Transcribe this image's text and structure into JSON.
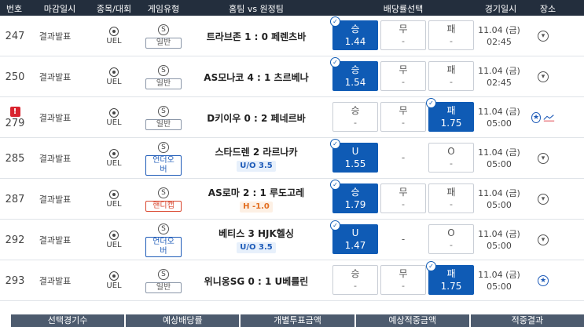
{
  "headers": [
    "번호",
    "마감일시",
    "종목/대회",
    "게임유형",
    "홈팀 vs 원정팀",
    "배당률선택",
    "경기일시",
    "장소"
  ],
  "rows": [
    {
      "no": "247",
      "status": "결과발표",
      "league": "UEL",
      "s": "S",
      "gtype": "일반",
      "gtype_style": "gray",
      "match": "트라브존 1 : 0 페렌츠바",
      "sub": "",
      "sub_style": "",
      "b1": {
        "label": "승",
        "odds": "1.44"
      },
      "b2": {
        "label": "무",
        "odds": "-"
      },
      "b3": {
        "label": "패",
        "odds": "-"
      },
      "sel": 1,
      "date": "11.04 (금)",
      "time": "02:45",
      "warn": false,
      "chart": false,
      "pin_blue": false
    },
    {
      "no": "250",
      "status": "결과발표",
      "league": "UEL",
      "s": "S",
      "gtype": "일반",
      "gtype_style": "gray",
      "match": "AS모나코 4 : 1 츠르베나",
      "sub": "",
      "sub_style": "",
      "b1": {
        "label": "승",
        "odds": "1.54"
      },
      "b2": {
        "label": "무",
        "odds": "-"
      },
      "b3": {
        "label": "패",
        "odds": "-"
      },
      "sel": 1,
      "date": "11.04 (금)",
      "time": "02:45",
      "warn": false,
      "chart": false,
      "pin_blue": false
    },
    {
      "no": "279",
      "status": "결과발표",
      "league": "UEL",
      "s": "S",
      "gtype": "일반",
      "gtype_style": "gray",
      "match": "D키이우 0 : 2 페네르바",
      "sub": "",
      "sub_style": "",
      "b1": {
        "label": "승",
        "odds": "-"
      },
      "b2": {
        "label": "무",
        "odds": "-"
      },
      "b3": {
        "label": "패",
        "odds": "1.75"
      },
      "sel": 3,
      "date": "11.04 (금)",
      "time": "05:00",
      "warn": true,
      "chart": true,
      "pin_blue": true
    },
    {
      "no": "285",
      "status": "결과발표",
      "league": "UEL",
      "s": "S",
      "gtype": "언더오버",
      "gtype_style": "blue",
      "match": "스타드렌   2   라르나카",
      "sub": "U/O 3.5",
      "sub_style": "blue",
      "b1": {
        "label": "U",
        "odds": "1.55"
      },
      "b2": {
        "label": "",
        "odds": "-"
      },
      "b3": {
        "label": "O",
        "odds": "-"
      },
      "sel": 1,
      "mid_dash": true,
      "date": "11.04 (금)",
      "time": "05:00",
      "warn": false,
      "chart": false,
      "pin_blue": false
    },
    {
      "no": "287",
      "status": "결과발표",
      "league": "UEL",
      "s": "S",
      "gtype": "핸디캡",
      "gtype_style": "red",
      "match": "AS로마 2 : 1 루도고레",
      "sub": "H -1.0",
      "sub_style": "red",
      "b1": {
        "label": "승",
        "odds": "1.79"
      },
      "b2": {
        "label": "무",
        "odds": "-"
      },
      "b3": {
        "label": "패",
        "odds": "-"
      },
      "sel": 1,
      "date": "11.04 (금)",
      "time": "05:00",
      "warn": false,
      "chart": false,
      "pin_blue": false
    },
    {
      "no": "292",
      "status": "결과발표",
      "league": "UEL",
      "s": "S",
      "gtype": "언더오버",
      "gtype_style": "blue",
      "match": "베티스   3   HJK헬싱",
      "sub": "U/O 3.5",
      "sub_style": "blue",
      "b1": {
        "label": "U",
        "odds": "1.47"
      },
      "b2": {
        "label": "",
        "odds": "-"
      },
      "b3": {
        "label": "O",
        "odds": "-"
      },
      "sel": 1,
      "mid_dash": true,
      "date": "11.04 (금)",
      "time": "05:00",
      "warn": false,
      "chart": false,
      "pin_blue": false
    },
    {
      "no": "293",
      "status": "결과발표",
      "league": "UEL",
      "s": "S",
      "gtype": "일반",
      "gtype_style": "gray",
      "match": "위니옹SG 0 : 1 U베를린",
      "sub": "",
      "sub_style": "",
      "b1": {
        "label": "승",
        "odds": "-"
      },
      "b2": {
        "label": "무",
        "odds": "-"
      },
      "b3": {
        "label": "패",
        "odds": "1.75"
      },
      "sel": 3,
      "date": "11.04 (금)",
      "time": "05:00",
      "warn": false,
      "chart": false,
      "pin_blue": true
    }
  ],
  "footer": [
    "선택경기수",
    "예상배당률",
    "개별투표금액",
    "예상적중금액",
    "적중결과"
  ],
  "colors": {
    "header_bg": "#232e3d",
    "selected": "#0f5bb5",
    "footer_bg": "#4d5b6e"
  }
}
